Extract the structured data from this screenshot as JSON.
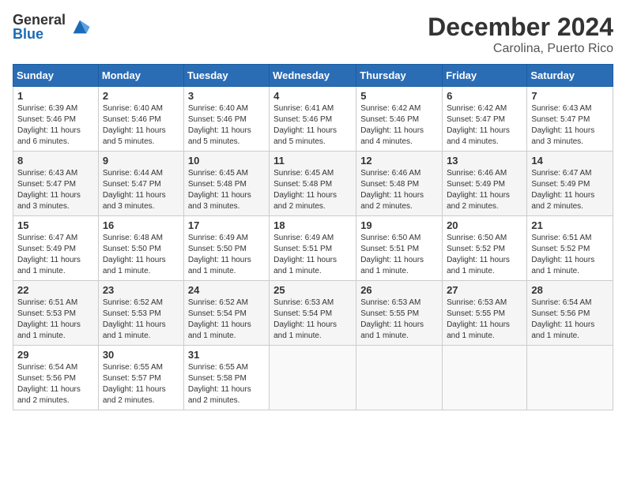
{
  "logo": {
    "general": "General",
    "blue": "Blue"
  },
  "header": {
    "month": "December 2024",
    "location": "Carolina, Puerto Rico"
  },
  "days_of_week": [
    "Sunday",
    "Monday",
    "Tuesday",
    "Wednesday",
    "Thursday",
    "Friday",
    "Saturday"
  ],
  "weeks": [
    [
      {
        "day": "1",
        "sunrise": "6:39 AM",
        "sunset": "5:46 PM",
        "daylight": "11 hours and 6 minutes."
      },
      {
        "day": "2",
        "sunrise": "6:40 AM",
        "sunset": "5:46 PM",
        "daylight": "11 hours and 5 minutes."
      },
      {
        "day": "3",
        "sunrise": "6:40 AM",
        "sunset": "5:46 PM",
        "daylight": "11 hours and 5 minutes."
      },
      {
        "day": "4",
        "sunrise": "6:41 AM",
        "sunset": "5:46 PM",
        "daylight": "11 hours and 5 minutes."
      },
      {
        "day": "5",
        "sunrise": "6:42 AM",
        "sunset": "5:46 PM",
        "daylight": "11 hours and 4 minutes."
      },
      {
        "day": "6",
        "sunrise": "6:42 AM",
        "sunset": "5:47 PM",
        "daylight": "11 hours and 4 minutes."
      },
      {
        "day": "7",
        "sunrise": "6:43 AM",
        "sunset": "5:47 PM",
        "daylight": "11 hours and 3 minutes."
      }
    ],
    [
      {
        "day": "8",
        "sunrise": "6:43 AM",
        "sunset": "5:47 PM",
        "daylight": "11 hours and 3 minutes."
      },
      {
        "day": "9",
        "sunrise": "6:44 AM",
        "sunset": "5:47 PM",
        "daylight": "11 hours and 3 minutes."
      },
      {
        "day": "10",
        "sunrise": "6:45 AM",
        "sunset": "5:48 PM",
        "daylight": "11 hours and 3 minutes."
      },
      {
        "day": "11",
        "sunrise": "6:45 AM",
        "sunset": "5:48 PM",
        "daylight": "11 hours and 2 minutes."
      },
      {
        "day": "12",
        "sunrise": "6:46 AM",
        "sunset": "5:48 PM",
        "daylight": "11 hours and 2 minutes."
      },
      {
        "day": "13",
        "sunrise": "6:46 AM",
        "sunset": "5:49 PM",
        "daylight": "11 hours and 2 minutes."
      },
      {
        "day": "14",
        "sunrise": "6:47 AM",
        "sunset": "5:49 PM",
        "daylight": "11 hours and 2 minutes."
      }
    ],
    [
      {
        "day": "15",
        "sunrise": "6:47 AM",
        "sunset": "5:49 PM",
        "daylight": "11 hours and 1 minute."
      },
      {
        "day": "16",
        "sunrise": "6:48 AM",
        "sunset": "5:50 PM",
        "daylight": "11 hours and 1 minute."
      },
      {
        "day": "17",
        "sunrise": "6:49 AM",
        "sunset": "5:50 PM",
        "daylight": "11 hours and 1 minute."
      },
      {
        "day": "18",
        "sunrise": "6:49 AM",
        "sunset": "5:51 PM",
        "daylight": "11 hours and 1 minute."
      },
      {
        "day": "19",
        "sunrise": "6:50 AM",
        "sunset": "5:51 PM",
        "daylight": "11 hours and 1 minute."
      },
      {
        "day": "20",
        "sunrise": "6:50 AM",
        "sunset": "5:52 PM",
        "daylight": "11 hours and 1 minute."
      },
      {
        "day": "21",
        "sunrise": "6:51 AM",
        "sunset": "5:52 PM",
        "daylight": "11 hours and 1 minute."
      }
    ],
    [
      {
        "day": "22",
        "sunrise": "6:51 AM",
        "sunset": "5:53 PM",
        "daylight": "11 hours and 1 minute."
      },
      {
        "day": "23",
        "sunrise": "6:52 AM",
        "sunset": "5:53 PM",
        "daylight": "11 hours and 1 minute."
      },
      {
        "day": "24",
        "sunrise": "6:52 AM",
        "sunset": "5:54 PM",
        "daylight": "11 hours and 1 minute."
      },
      {
        "day": "25",
        "sunrise": "6:53 AM",
        "sunset": "5:54 PM",
        "daylight": "11 hours and 1 minute."
      },
      {
        "day": "26",
        "sunrise": "6:53 AM",
        "sunset": "5:55 PM",
        "daylight": "11 hours and 1 minute."
      },
      {
        "day": "27",
        "sunrise": "6:53 AM",
        "sunset": "5:55 PM",
        "daylight": "11 hours and 1 minute."
      },
      {
        "day": "28",
        "sunrise": "6:54 AM",
        "sunset": "5:56 PM",
        "daylight": "11 hours and 1 minute."
      }
    ],
    [
      {
        "day": "29",
        "sunrise": "6:54 AM",
        "sunset": "5:56 PM",
        "daylight": "11 hours and 2 minutes."
      },
      {
        "day": "30",
        "sunrise": "6:55 AM",
        "sunset": "5:57 PM",
        "daylight": "11 hours and 2 minutes."
      },
      {
        "day": "31",
        "sunrise": "6:55 AM",
        "sunset": "5:58 PM",
        "daylight": "11 hours and 2 minutes."
      },
      null,
      null,
      null,
      null
    ]
  ]
}
